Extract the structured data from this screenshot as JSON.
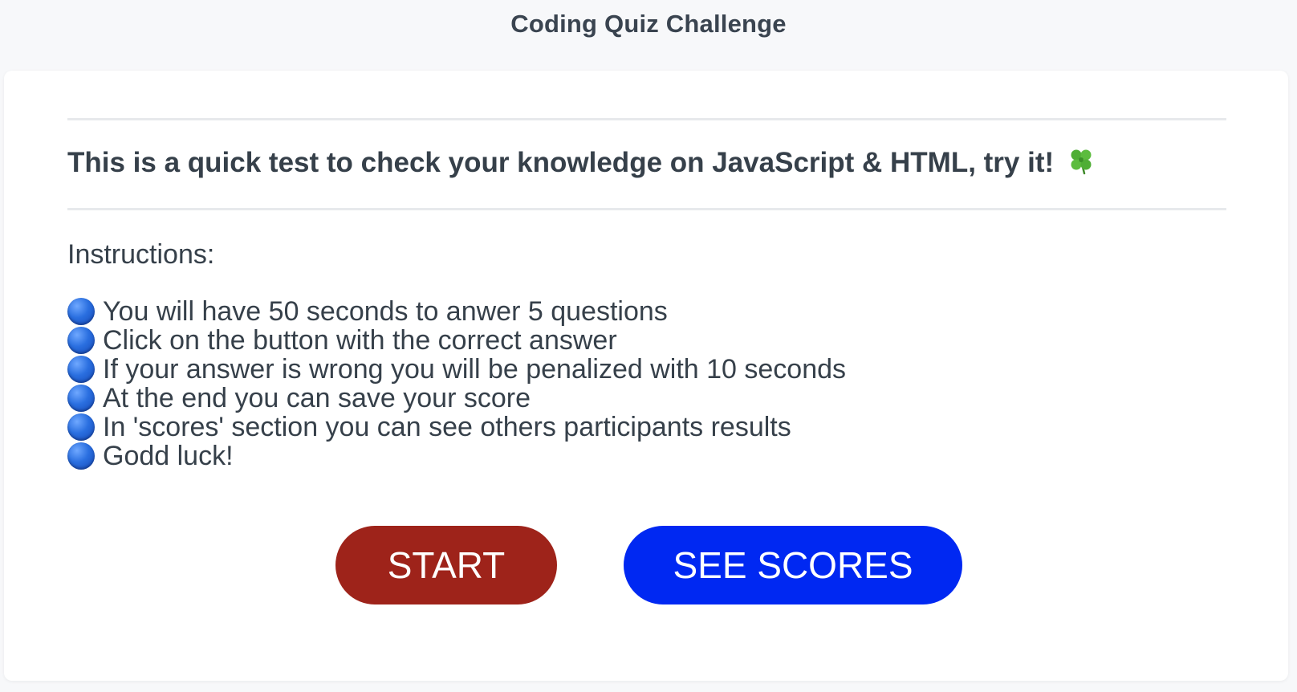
{
  "header": {
    "title": "Coding Quiz Challenge"
  },
  "main": {
    "intro": "This is a quick test to check your knowledge on JavaScript & HTML, try it!",
    "intro_icon": "four-leaf-clover-icon",
    "instructions_label": "Instructions:",
    "instructions": [
      "You will have 50 seconds to anwer 5 questions",
      "Click on the button with the correct answer",
      "If your answer is wrong you will be penalized with 10 seconds",
      "At the end you can save your score",
      "In 'scores' section you can see others participants results",
      "Godd luck!"
    ],
    "bullet_icon": "blue-circle-icon"
  },
  "buttons": {
    "start_label": "START",
    "scores_label": "SEE SCORES"
  },
  "colors": {
    "start": "#9e231a",
    "scores": "#0028f2",
    "bullet": "#2a6fe0",
    "text": "#36404a"
  }
}
